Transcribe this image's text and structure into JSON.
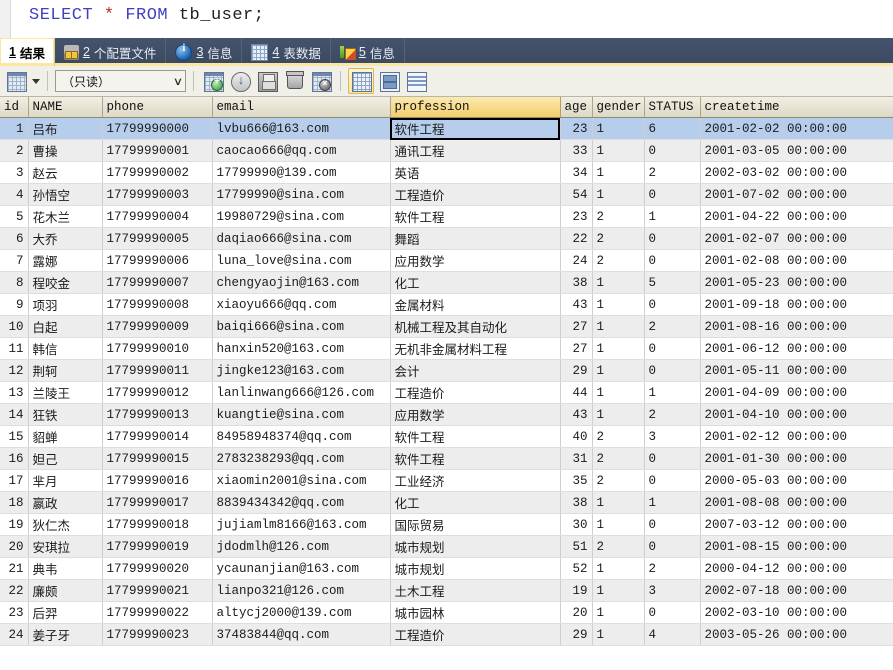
{
  "editor": {
    "sql_keyword1": "SELECT",
    "sql_star": "*",
    "sql_keyword2": "FROM",
    "sql_table": "tb_user;"
  },
  "tabs": [
    {
      "num": "1",
      "label": "结果",
      "icon": "",
      "active": true
    },
    {
      "num": "2",
      "label": "个配置文件",
      "icon": "config-icon",
      "active": false
    },
    {
      "num": "3",
      "label": "信息",
      "icon": "info-icon",
      "active": false
    },
    {
      "num": "4",
      "label": "表数据",
      "icon": "grid-icon",
      "active": false
    },
    {
      "num": "5",
      "label": "信息",
      "icon": "status-icon",
      "active": false
    }
  ],
  "toolbar": {
    "mode_dropdown_value": "（只读）",
    "mode_dropdown_chevron": "∨",
    "buttons": [
      {
        "name": "grid-mode-dropdown-button",
        "icon": "sheet-arrow-icon"
      },
      {
        "name": "insert-record-button",
        "icon": "sheet-plus-icon"
      },
      {
        "name": "refresh-button",
        "icon": "refresh-icon"
      },
      {
        "name": "apply-changes-button",
        "icon": "save-icon"
      },
      {
        "name": "delete-record-button",
        "icon": "trash-icon"
      },
      {
        "name": "discard-changes-button",
        "icon": "sheet-x-icon"
      },
      {
        "name": "grid-view-button",
        "icon": "grid-view-icon",
        "active": true
      },
      {
        "name": "form-view-button",
        "icon": "form-view-icon",
        "active": false
      },
      {
        "name": "text-view-button",
        "icon": "text-view-icon",
        "active": false
      }
    ]
  },
  "grid": {
    "columns": [
      {
        "key": "id",
        "label": "id",
        "cls": "c-id",
        "align": "num"
      },
      {
        "key": "name",
        "label": "NAME",
        "cls": "c-name",
        "align": ""
      },
      {
        "key": "phone",
        "label": "phone",
        "cls": "c-phone",
        "align": ""
      },
      {
        "key": "email",
        "label": "email",
        "cls": "c-email",
        "align": ""
      },
      {
        "key": "profession",
        "label": "profession",
        "cls": "c-prof",
        "align": "",
        "highlight": true
      },
      {
        "key": "age",
        "label": "age",
        "cls": "c-age",
        "align": "num"
      },
      {
        "key": "gender",
        "label": "gender",
        "cls": "c-gender",
        "align": ""
      },
      {
        "key": "status",
        "label": "STATUS",
        "cls": "c-status",
        "align": ""
      },
      {
        "key": "createtime",
        "label": "createtime",
        "cls": "c-create",
        "align": ""
      }
    ],
    "selected_row": 0,
    "selected_column": "profession",
    "rows": [
      {
        "id": "1",
        "name": "吕布",
        "phone": "17799990000",
        "email": "lvbu666@163.com",
        "profession": "软件工程",
        "age": "23",
        "gender": "1",
        "status": "6",
        "createtime": "2001-02-02 00:00:00"
      },
      {
        "id": "2",
        "name": "曹操",
        "phone": "17799990001",
        "email": "caocao666@qq.com",
        "profession": "通讯工程",
        "age": "33",
        "gender": "1",
        "status": "0",
        "createtime": "2001-03-05 00:00:00"
      },
      {
        "id": "3",
        "name": "赵云",
        "phone": "17799990002",
        "email": "17799990@139.com",
        "profession": "英语",
        "age": "34",
        "gender": "1",
        "status": "2",
        "createtime": "2002-03-02 00:00:00"
      },
      {
        "id": "4",
        "name": "孙悟空",
        "phone": "17799990003",
        "email": "17799990@sina.com",
        "profession": "工程造价",
        "age": "54",
        "gender": "1",
        "status": "0",
        "createtime": "2001-07-02 00:00:00"
      },
      {
        "id": "5",
        "name": "花木兰",
        "phone": "17799990004",
        "email": "19980729@sina.com",
        "profession": "软件工程",
        "age": "23",
        "gender": "2",
        "status": "1",
        "createtime": "2001-04-22 00:00:00"
      },
      {
        "id": "6",
        "name": "大乔",
        "phone": "17799990005",
        "email": "daqiao666@sina.com",
        "profession": "舞蹈",
        "age": "22",
        "gender": "2",
        "status": "0",
        "createtime": "2001-02-07 00:00:00"
      },
      {
        "id": "7",
        "name": "露娜",
        "phone": "17799990006",
        "email": "luna_love@sina.com",
        "profession": "应用数学",
        "age": "24",
        "gender": "2",
        "status": "0",
        "createtime": "2001-02-08 00:00:00"
      },
      {
        "id": "8",
        "name": "程咬金",
        "phone": "17799990007",
        "email": "chengyaojin@163.com",
        "profession": "化工",
        "age": "38",
        "gender": "1",
        "status": "5",
        "createtime": "2001-05-23 00:00:00"
      },
      {
        "id": "9",
        "name": "项羽",
        "phone": "17799990008",
        "email": "xiaoyu666@qq.com",
        "profession": "金属材料",
        "age": "43",
        "gender": "1",
        "status": "0",
        "createtime": "2001-09-18 00:00:00"
      },
      {
        "id": "10",
        "name": "白起",
        "phone": "17799990009",
        "email": "baiqi666@sina.com",
        "profession": "机械工程及其自动化",
        "age": "27",
        "gender": "1",
        "status": "2",
        "createtime": "2001-08-16 00:00:00"
      },
      {
        "id": "11",
        "name": "韩信",
        "phone": "17799990010",
        "email": "hanxin520@163.com",
        "profession": "无机非金属材料工程",
        "age": "27",
        "gender": "1",
        "status": "0",
        "createtime": "2001-06-12 00:00:00"
      },
      {
        "id": "12",
        "name": "荆轲",
        "phone": "17799990011",
        "email": "jingke123@163.com",
        "profession": "会计",
        "age": "29",
        "gender": "1",
        "status": "0",
        "createtime": "2001-05-11 00:00:00"
      },
      {
        "id": "13",
        "name": "兰陵王",
        "phone": "17799990012",
        "email": "lanlinwang666@126.com",
        "profession": "工程造价",
        "age": "44",
        "gender": "1",
        "status": "1",
        "createtime": "2001-04-09 00:00:00"
      },
      {
        "id": "14",
        "name": "狂铁",
        "phone": "17799990013",
        "email": "kuangtie@sina.com",
        "profession": "应用数学",
        "age": "43",
        "gender": "1",
        "status": "2",
        "createtime": "2001-04-10 00:00:00"
      },
      {
        "id": "15",
        "name": "貂蝉",
        "phone": "17799990014",
        "email": "84958948374@qq.com",
        "profession": "软件工程",
        "age": "40",
        "gender": "2",
        "status": "3",
        "createtime": "2001-02-12 00:00:00"
      },
      {
        "id": "16",
        "name": "妲己",
        "phone": "17799990015",
        "email": "2783238293@qq.com",
        "profession": "软件工程",
        "age": "31",
        "gender": "2",
        "status": "0",
        "createtime": "2001-01-30 00:00:00"
      },
      {
        "id": "17",
        "name": "芈月",
        "phone": "17799990016",
        "email": "xiaomin2001@sina.com",
        "profession": "工业经济",
        "age": "35",
        "gender": "2",
        "status": "0",
        "createtime": "2000-05-03 00:00:00"
      },
      {
        "id": "18",
        "name": "嬴政",
        "phone": "17799990017",
        "email": "8839434342@qq.com",
        "profession": "化工",
        "age": "38",
        "gender": "1",
        "status": "1",
        "createtime": "2001-08-08 00:00:00"
      },
      {
        "id": "19",
        "name": "狄仁杰",
        "phone": "17799990018",
        "email": "jujiamlm8166@163.com",
        "profession": "国际贸易",
        "age": "30",
        "gender": "1",
        "status": "0",
        "createtime": "2007-03-12 00:00:00"
      },
      {
        "id": "20",
        "name": "安琪拉",
        "phone": "17799990019",
        "email": "jdodmlh@126.com",
        "profession": "城市规划",
        "age": "51",
        "gender": "2",
        "status": "0",
        "createtime": "2001-08-15 00:00:00"
      },
      {
        "id": "21",
        "name": "典韦",
        "phone": "17799990020",
        "email": "ycaunanjian@163.com",
        "profession": "城市规划",
        "age": "52",
        "gender": "1",
        "status": "2",
        "createtime": "2000-04-12 00:00:00"
      },
      {
        "id": "22",
        "name": "廉颇",
        "phone": "17799990021",
        "email": "lianpo321@126.com",
        "profession": "土木工程",
        "age": "19",
        "gender": "1",
        "status": "3",
        "createtime": "2002-07-18 00:00:00"
      },
      {
        "id": "23",
        "name": "后羿",
        "phone": "17799990022",
        "email": "altycj2000@139.com",
        "profession": "城市园林",
        "age": "20",
        "gender": "1",
        "status": "0",
        "createtime": "2002-03-10 00:00:00"
      },
      {
        "id": "24",
        "name": "姜子牙",
        "phone": "17799990023",
        "email": "37483844@qq.com",
        "profession": "工程造价",
        "age": "29",
        "gender": "1",
        "status": "4",
        "createtime": "2003-05-26 00:00:00"
      }
    ]
  }
}
